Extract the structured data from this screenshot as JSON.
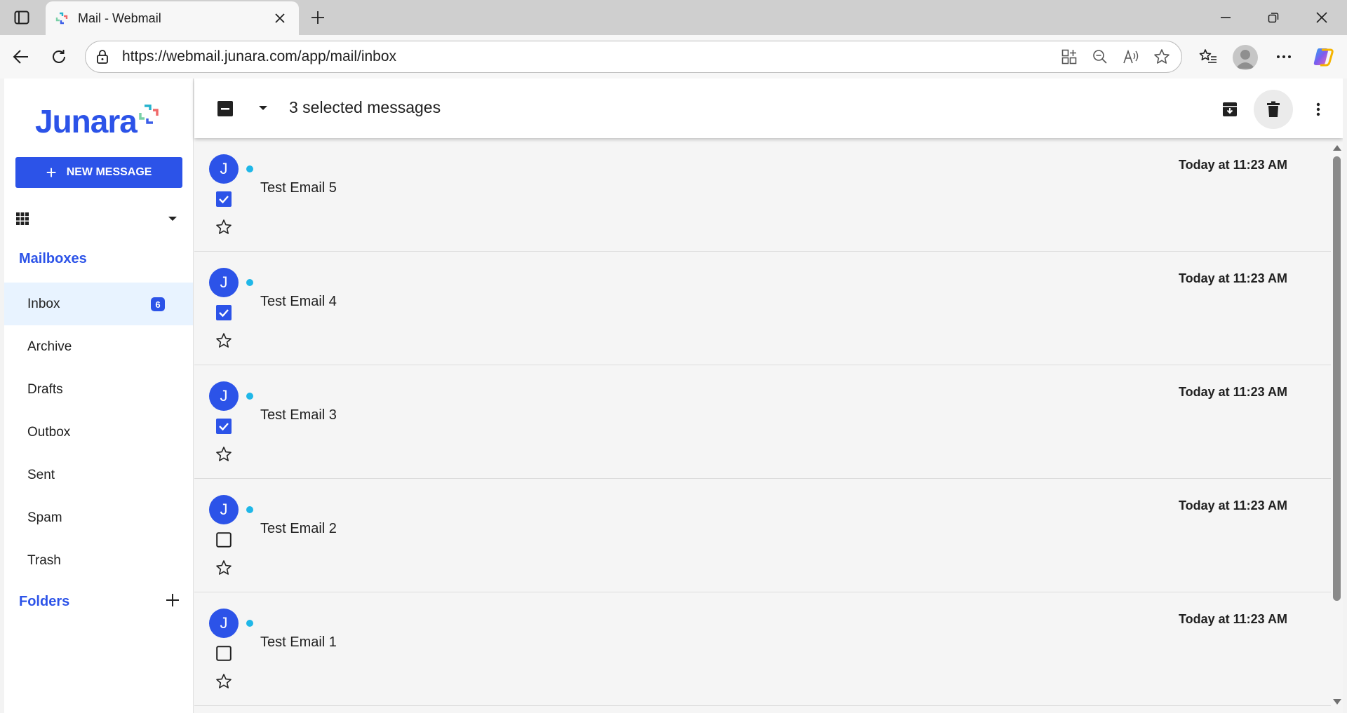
{
  "browser": {
    "tab_title": "Mail - Webmail",
    "url": "https://webmail.junara.com/app/mail/inbox"
  },
  "sidebar": {
    "logo_text": "Junara",
    "new_message_label": "NEW MESSAGE",
    "mailboxes_title": "Mailboxes",
    "mailboxes": [
      {
        "label": "Inbox",
        "badge": "6",
        "active": true
      },
      {
        "label": "Archive"
      },
      {
        "label": "Drafts"
      },
      {
        "label": "Outbox"
      },
      {
        "label": "Sent"
      },
      {
        "label": "Spam"
      },
      {
        "label": "Trash"
      }
    ],
    "folders_title": "Folders"
  },
  "toolbar": {
    "selected_text": "3 selected messages"
  },
  "messages": [
    {
      "avatar": "J",
      "subject": "Test Email 5",
      "time": "Today at 11:23 AM",
      "checked": true
    },
    {
      "avatar": "J",
      "subject": "Test Email 4",
      "time": "Today at 11:23 AM",
      "checked": true
    },
    {
      "avatar": "J",
      "subject": "Test Email 3",
      "time": "Today at 11:23 AM",
      "checked": true
    },
    {
      "avatar": "J",
      "subject": "Test Email 2",
      "time": "Today at 11:23 AM",
      "checked": false
    },
    {
      "avatar": "J",
      "subject": "Test Email 1",
      "time": "Today at 11:23 AM",
      "checked": false
    }
  ],
  "colors": {
    "brand": "#2c53e8",
    "unread_dot": "#1fb7e8",
    "active_mailbox_bg": "#e8f3ff"
  }
}
